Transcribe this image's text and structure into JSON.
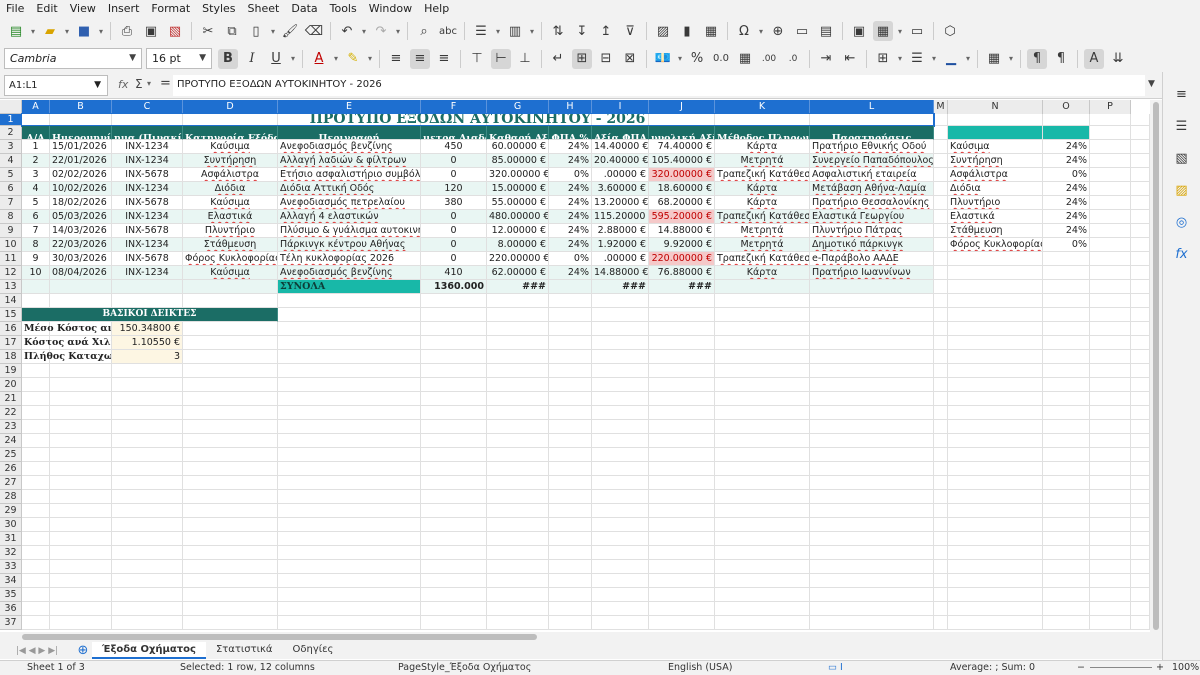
{
  "menu": [
    "File",
    "Edit",
    "View",
    "Insert",
    "Format",
    "Styles",
    "Sheet",
    "Data",
    "Tools",
    "Window",
    "Help"
  ],
  "toolbar": {
    "font_name": "Cambria",
    "font_size": "16 pt"
  },
  "formula_bar": {
    "cell_ref": "A1:L1",
    "content": "ΠΡΟΤΥΠΟ ΕΞΟΔΩΝ ΑΥΤΟΚΙΝΗΤΟΥ - 2026"
  },
  "columns": [
    "A",
    "B",
    "C",
    "D",
    "E",
    "F",
    "G",
    "H",
    "I",
    "J",
    "K",
    "L",
    "M",
    "N",
    "O",
    "P"
  ],
  "sheet": {
    "title": "ΠΡΟΤΥΠΟ ΕΞΟΔΩΝ ΑΥΤΟΚΙΝΗΤΟΥ - 2026",
    "headers": [
      "Α/Α",
      "Ημερομηνία",
      "ημα (Πινακίδ",
      "Κατηγορία Εξόδου",
      "Περιγραφή",
      "μετρα Διαδρ",
      "Καθαρή Αξί",
      "ΦΠΑ %",
      "Αξία ΦΠΑ",
      "υνολική Αξί",
      "Μέθοδος Πληρωμή",
      "Παρατηρήσεις"
    ],
    "rows": [
      [
        "1",
        "15/01/2026",
        "INX-1234",
        "Καύσιμα",
        "Ανεφοδιασμός βενζίνης",
        "450",
        "60.00000 €",
        "24%",
        "14.40000 €",
        "74.40000 €",
        "Κάρτα",
        "Πρατήριο Εθνικής Οδού"
      ],
      [
        "2",
        "22/01/2026",
        "INX-1234",
        "Συντήρηση",
        "Αλλαγή λαδιών & φίλτρων",
        "0",
        "85.00000 €",
        "24%",
        "20.40000 €",
        "105.40000 €",
        "Μετρητά",
        "Συνεργείο Παπαδόπουλος"
      ],
      [
        "3",
        "02/02/2026",
        "INX-5678",
        "Ασφάλιστρα",
        "Ετήσιο ασφαλιστήριο συμβόλαιο",
        "0",
        "320.00000 €",
        "0%",
        ".00000 €",
        "320.00000 €",
        "Τραπεζική Κατάθεση",
        "Ασφαλιστική εταιρεία"
      ],
      [
        "4",
        "10/02/2026",
        "INX-1234",
        "Διόδια",
        "Διόδια Αττική Οδός",
        "120",
        "15.00000 €",
        "24%",
        "3.60000 €",
        "18.60000 €",
        "Κάρτα",
        "Μετάβαση Αθήνα-Λαμία"
      ],
      [
        "5",
        "18/02/2026",
        "INX-5678",
        "Καύσιμα",
        "Ανεφοδιασμός πετρελαίου",
        "380",
        "55.00000 €",
        "24%",
        "13.20000 €",
        "68.20000 €",
        "Κάρτα",
        "Πρατήριο Θεσσαλονίκης"
      ],
      [
        "6",
        "05/03/2026",
        "INX-1234",
        "Ελαστικά",
        "Αλλαγή 4 ελαστικών",
        "0",
        "480.00000 €",
        "24%",
        "115.20000 €",
        "595.20000 €",
        "Τραπεζική Κατάθεση",
        "Ελαστικά Γεωργίου"
      ],
      [
        "7",
        "14/03/2026",
        "INX-5678",
        "Πλυντήριο",
        "Πλύσιμο & γυάλισμα αυτοκινήτου",
        "0",
        "12.00000 €",
        "24%",
        "2.88000 €",
        "14.88000 €",
        "Μετρητά",
        "Πλυντήριο Πάτρας"
      ],
      [
        "8",
        "22/03/2026",
        "INX-1234",
        "Στάθμευση",
        "Πάρκινγκ κέντρου Αθήνας",
        "0",
        "8.00000 €",
        "24%",
        "1.92000 €",
        "9.92000 €",
        "Μετρητά",
        "Δημοτικό πάρκινγκ"
      ],
      [
        "9",
        "30/03/2026",
        "INX-5678",
        "Φόρος Κυκλοφορίας",
        "Τέλη κυκλοφορίας 2026",
        "0",
        "220.00000 €",
        "0%",
        ".00000 €",
        "220.00000 €",
        "Τραπεζική Κατάθεση",
        "e-Παράβολο ΑΑΔΕ"
      ],
      [
        "10",
        "08/04/2026",
        "INX-1234",
        "Καύσιμα",
        "Ανεφοδιασμός βενζίνης",
        "410",
        "62.00000 €",
        "24%",
        "14.88000 €",
        "76.88000 €",
        "Κάρτα",
        "Πρατήριο Ιωαννίνων"
      ]
    ],
    "totals": {
      "label": "ΣΥΝΟΛΑ",
      "f": "1360.000",
      "g": "###",
      "i": "###",
      "j": "###"
    },
    "kpi": {
      "title": "ΒΑΣΙΚΟΙ ΔΕΙΚΤΕΣ",
      "rows": [
        [
          "Μέσο Κόστος ανά",
          "150.34800 €"
        ],
        [
          "Κόστος ανά Χιλιό",
          "1.10550 €"
        ],
        [
          "Πλήθος Καταχωρ",
          "3"
        ]
      ]
    },
    "vat_table": {
      "headers": [
        "Κατηγορία",
        "ΦΠΑ %"
      ],
      "rows": [
        [
          "Καύσιμα",
          "24%"
        ],
        [
          "Συντήρηση",
          "24%"
        ],
        [
          "Ασφάλιστρα",
          "0%"
        ],
        [
          "Διόδια",
          "24%"
        ],
        [
          "Πλυντήριο",
          "24%"
        ],
        [
          "Ελαστικά",
          "24%"
        ],
        [
          "Στάθμευση",
          "24%"
        ],
        [
          "Φόρος Κυκλοφορίας",
          "0%"
        ]
      ]
    }
  },
  "tabs": [
    "Έξοδα Οχήματος",
    "Στατιστικά",
    "Οδηγίες"
  ],
  "status": {
    "sheet": "Sheet 1 of 3",
    "selected": "Selected: 1 row, 12 columns",
    "pagestyle": "PageStyle_Έξοδα Οχήματος",
    "lang": "English (USA)",
    "sum": "Average: ; Sum: 0",
    "zoom": "100%"
  },
  "colors": {
    "header": "#1b6d65",
    "accent": "#18b8a8",
    "highlight": "#f5c9c9",
    "alt_row": "#e9f6f3",
    "selection": "#1e6fd0"
  }
}
